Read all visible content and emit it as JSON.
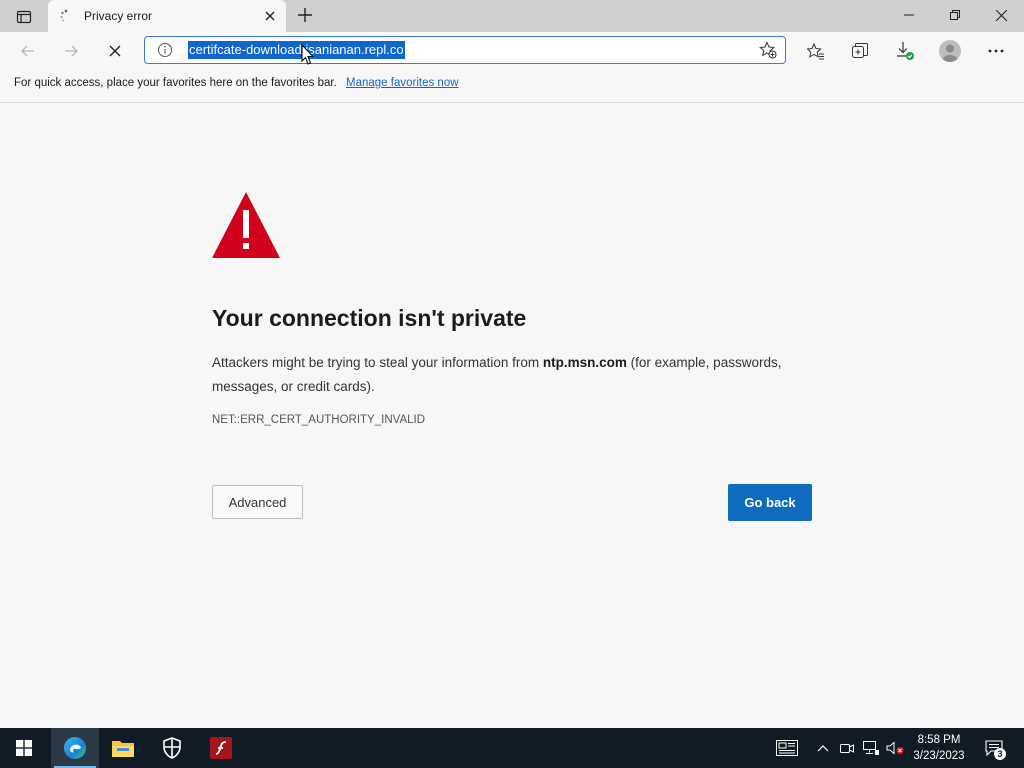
{
  "tab": {
    "title": "Privacy error"
  },
  "address": {
    "url": "certifcate-download.isanianan.repl.co"
  },
  "favorites_bar": {
    "message": "For quick access, place your favorites here on the favorites bar.",
    "link": "Manage favorites now"
  },
  "error": {
    "heading": "Your connection isn't private",
    "desc_before": "Attackers might be trying to steal your information from ",
    "host": "ntp.msn.com",
    "desc_after": " (for example, passwords, messages, or credit cards).",
    "code": "NET::ERR_CERT_AUTHORITY_INVALID",
    "advanced_label": "Advanced",
    "go_back_label": "Go back"
  },
  "taskbar": {
    "time": "8:58 PM",
    "date": "3/23/2023",
    "notification_count": "3"
  },
  "colors": {
    "accent": "#0f6cbd",
    "warning_red": "#d0021b",
    "taskbar": "#101b26"
  }
}
